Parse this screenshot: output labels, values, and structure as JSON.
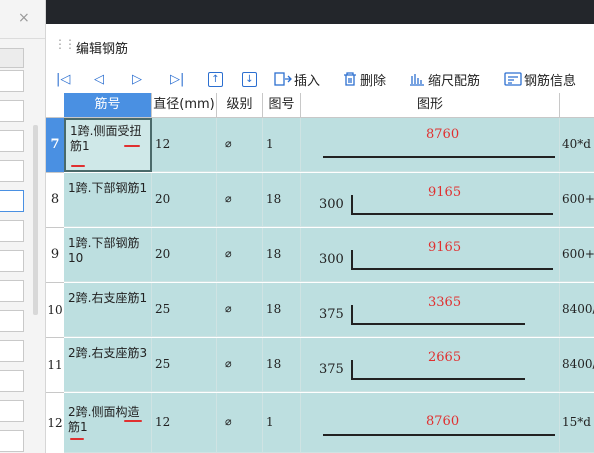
{
  "left_panel": {
    "close_glyph": "×"
  },
  "window": {
    "title": "编辑钢筋"
  },
  "toolbar": {
    "first_glyph": "|◁",
    "prev_glyph": "◁",
    "next_glyph": "▷",
    "last_glyph": "▷|",
    "move_up_glyph": "↑",
    "move_down_glyph": "↓",
    "insert_label": "插入",
    "delete_label": "删除",
    "scale_label": "缩尺配筋",
    "info_label": "钢筋信息"
  },
  "table": {
    "headers": {
      "name": "筋号",
      "diameter": "直径(mm)",
      "grade": "级别",
      "figure_no": "图号",
      "shape": "图形"
    },
    "grade_symbol": "⌀",
    "rows": [
      {
        "num": "7",
        "name": "1跨.侧面受扭筋1",
        "diameter": "12",
        "figure_no": "1",
        "shape_left": "",
        "shape_value": "8760",
        "formula": "40*d"
      },
      {
        "num": "8",
        "name": "1跨.下部钢筋1",
        "diameter": "20",
        "figure_no": "18",
        "shape_left": "300",
        "shape_value": "9165",
        "formula": "600+"
      },
      {
        "num": "9",
        "name": "1跨.下部钢筋10",
        "diameter": "20",
        "figure_no": "18",
        "shape_left": "300",
        "shape_value": "9165",
        "formula": "600+"
      },
      {
        "num": "10",
        "name": "2跨.右支座筋1",
        "diameter": "25",
        "figure_no": "18",
        "shape_left": "375",
        "shape_value": "3365",
        "formula": "8400/"
      },
      {
        "num": "11",
        "name": "2跨.右支座筋3",
        "diameter": "25",
        "figure_no": "18",
        "shape_left": "375",
        "shape_value": "2665",
        "formula": "8400/"
      },
      {
        "num": "12",
        "name": "2跨.侧面构造筋1",
        "diameter": "12",
        "figure_no": "1",
        "shape_left": "",
        "shape_value": "8760",
        "formula": "15*d"
      }
    ]
  },
  "colors": {
    "accent": "#4a90e2",
    "cell_bg": "#bddfe0",
    "mark_red": "#e03030",
    "topbar": "#23262b"
  }
}
